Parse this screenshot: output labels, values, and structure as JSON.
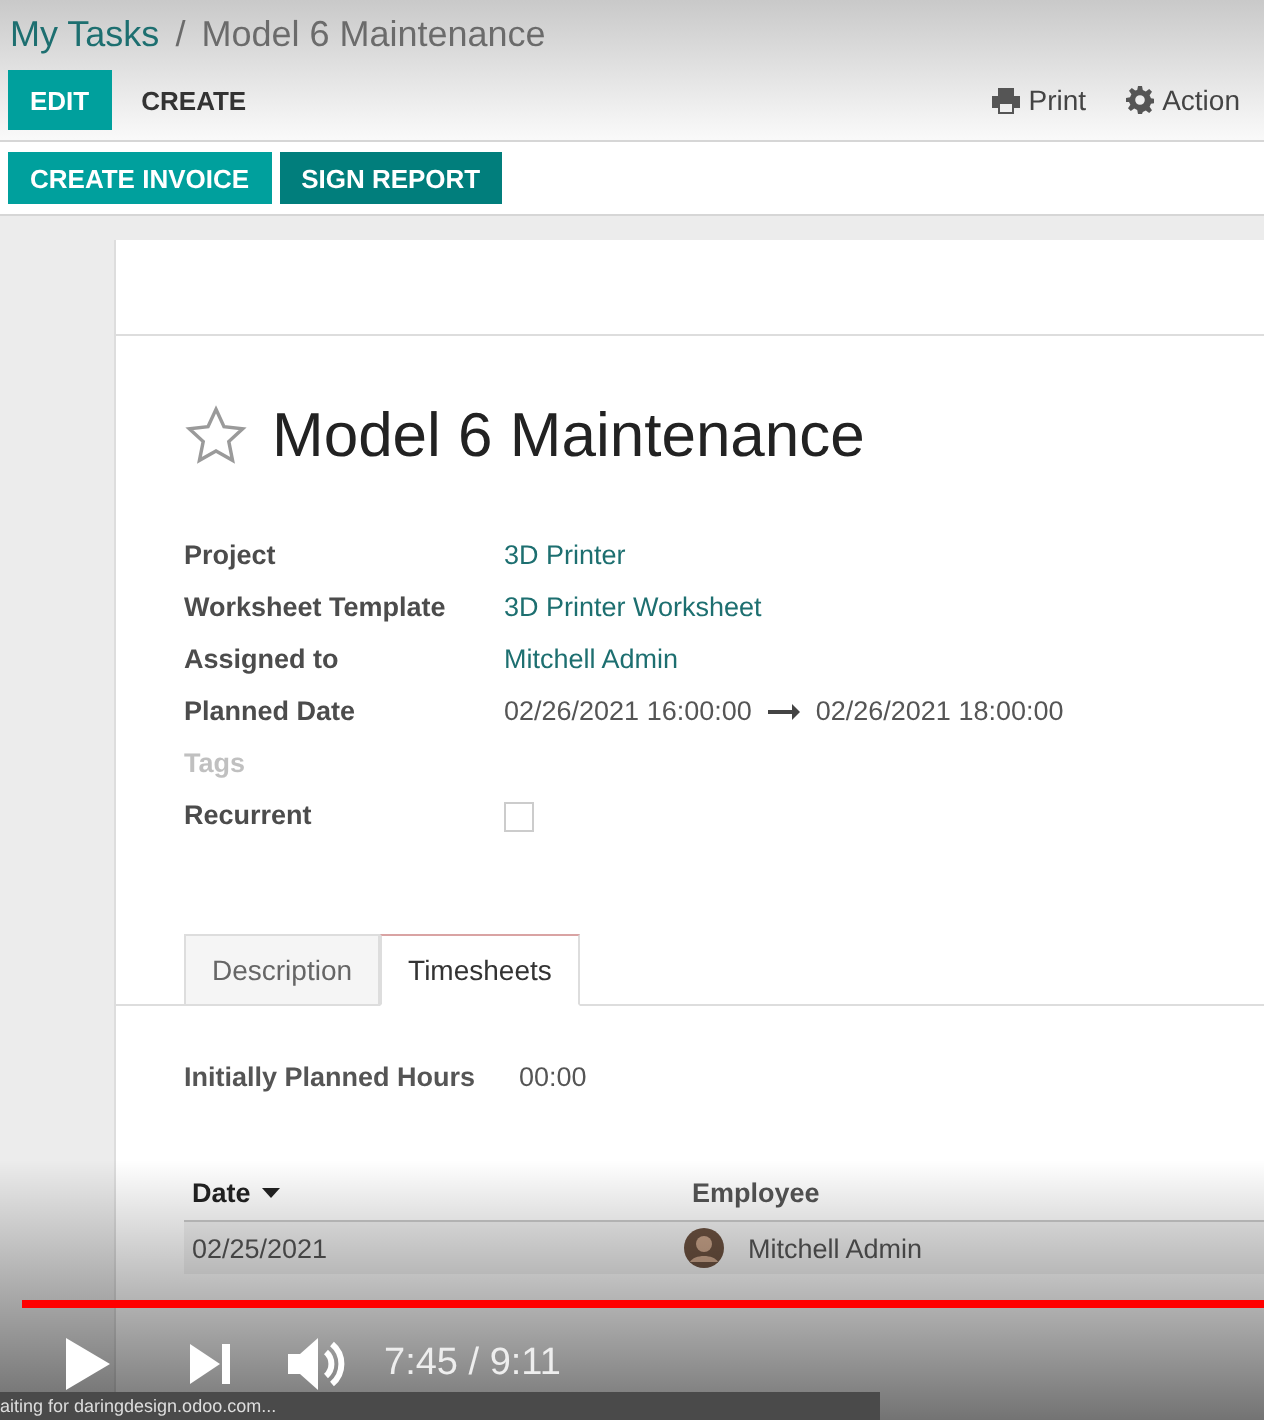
{
  "breadcrumb": [
    {
      "label": "My Tasks",
      "kind": "link"
    },
    {
      "label": "Model 6 Maintenance",
      "kind": "current"
    }
  ],
  "breadcrumb_separator": "/",
  "toolbar": {
    "buttons": [
      {
        "label": "EDIT",
        "kind": "primary"
      },
      {
        "label": "CREATE",
        "kind": "plain"
      }
    ],
    "actions": [
      {
        "label": "Print",
        "kind": "print"
      },
      {
        "label": "Action",
        "kind": "gear"
      }
    ]
  },
  "header_buttons": [
    {
      "label": "CREATE INVOICE",
      "hovered": false
    },
    {
      "label": "SIGN REPORT",
      "hovered": true
    }
  ],
  "task": {
    "title": "Model 6 Maintenance",
    "starred": false,
    "fields": [
      {
        "label": "Project",
        "kind": "link",
        "value": "3D Printer"
      },
      {
        "label": "Worksheet Template",
        "kind": "link",
        "value": "3D Printer Worksheet"
      },
      {
        "label": "Assigned to",
        "kind": "link",
        "value": "Mitchell Admin"
      },
      {
        "label": "Planned Date",
        "kind": "range",
        "from": "02/26/2021 16:00:00",
        "to": "02/26/2021 18:00:00"
      },
      {
        "label": "Tags",
        "kind": "empty"
      },
      {
        "label": "Recurrent",
        "kind": "checkbox",
        "checked": false
      }
    ]
  },
  "tabs": [
    {
      "label": "Description",
      "selected": false
    },
    {
      "label": "Timesheets",
      "selected": true
    }
  ],
  "planned_hours": {
    "label": "Initially Planned Hours",
    "value": "00:00"
  },
  "table": {
    "columns": [
      {
        "label": "Date",
        "sorted": true
      },
      {
        "label": "Employee",
        "sorted": false
      }
    ],
    "rows": [
      {
        "date": "02/25/2021",
        "employee": "Mitchell Admin"
      }
    ]
  },
  "player": {
    "progress": {
      "level": 1
    },
    "playing": false,
    "time": "7:45 / 9:11"
  },
  "status_text": "aiting for daringdesign.odoo.com..."
}
